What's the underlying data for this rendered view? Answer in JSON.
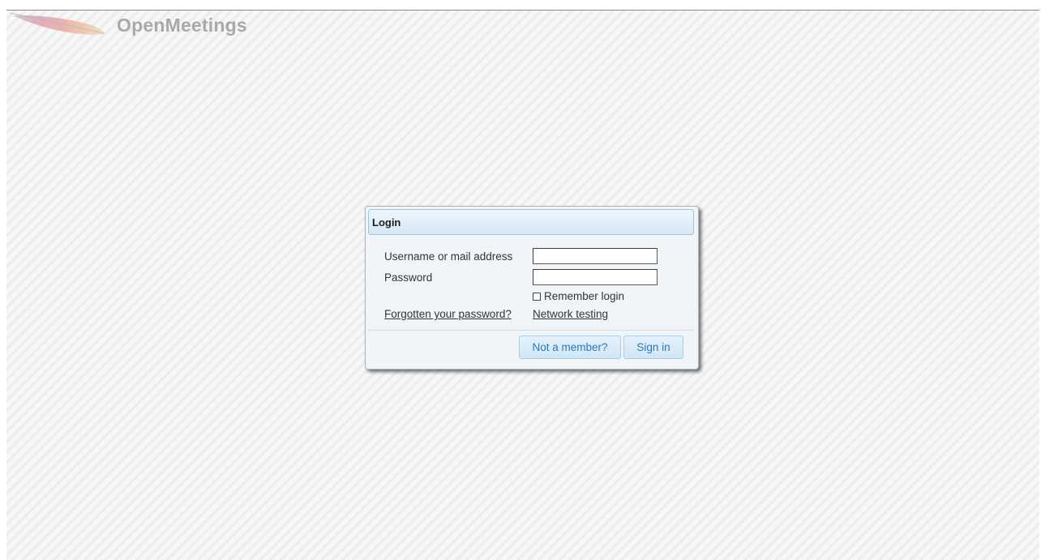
{
  "app": {
    "title": "OpenMeetings",
    "logo_icon": "apache-feather-icon"
  },
  "login": {
    "title": "Login",
    "username_label": "Username or mail address",
    "username_value": "",
    "password_label": "Password",
    "password_value": "",
    "remember_label": "Remember login",
    "remember_checked": false,
    "forgot_link": "Forgotten your password?",
    "network_link": "Network testing",
    "not_member_button": "Not a member?",
    "sign_in_button": "Sign in"
  },
  "colors": {
    "accent": "#2b78b6",
    "title_gray": "#a9a9a9",
    "dialog_bg": "#f2f5f8"
  }
}
